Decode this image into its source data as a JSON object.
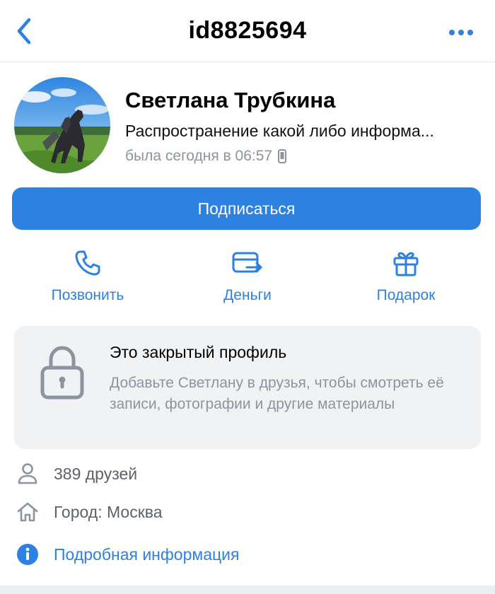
{
  "header": {
    "title": "id8825694",
    "back_icon": "chevron-left-icon",
    "more_icon": "more-horizontal-icon"
  },
  "profile": {
    "name": "Светлана Трубкина",
    "status": "Распространение какой либо информа...",
    "last_seen": "была сегодня в 06:57",
    "device_icon": "mobile-phone-icon",
    "avatar_icon": "avatar-photo"
  },
  "subscribe_button": {
    "label": "Подписаться"
  },
  "actions": [
    {
      "label": "Позвонить",
      "icon": "phone-icon"
    },
    {
      "label": "Деньги",
      "icon": "money-transfer-icon"
    },
    {
      "label": "Подарок",
      "icon": "gift-icon"
    }
  ],
  "closed_profile": {
    "title": "Это закрытый профиль",
    "description": "Добавьте Светлану в друзья, чтобы смотреть её записи, фотографии и другие материалы",
    "icon": "lock-icon"
  },
  "info": {
    "friends": "389 друзей",
    "city": "Город: Москва",
    "details_link": "Подробная информация"
  },
  "colors": {
    "accent": "#2d81e0",
    "secondary_text": "#8d949e",
    "card_bg": "#f1f2f4"
  }
}
